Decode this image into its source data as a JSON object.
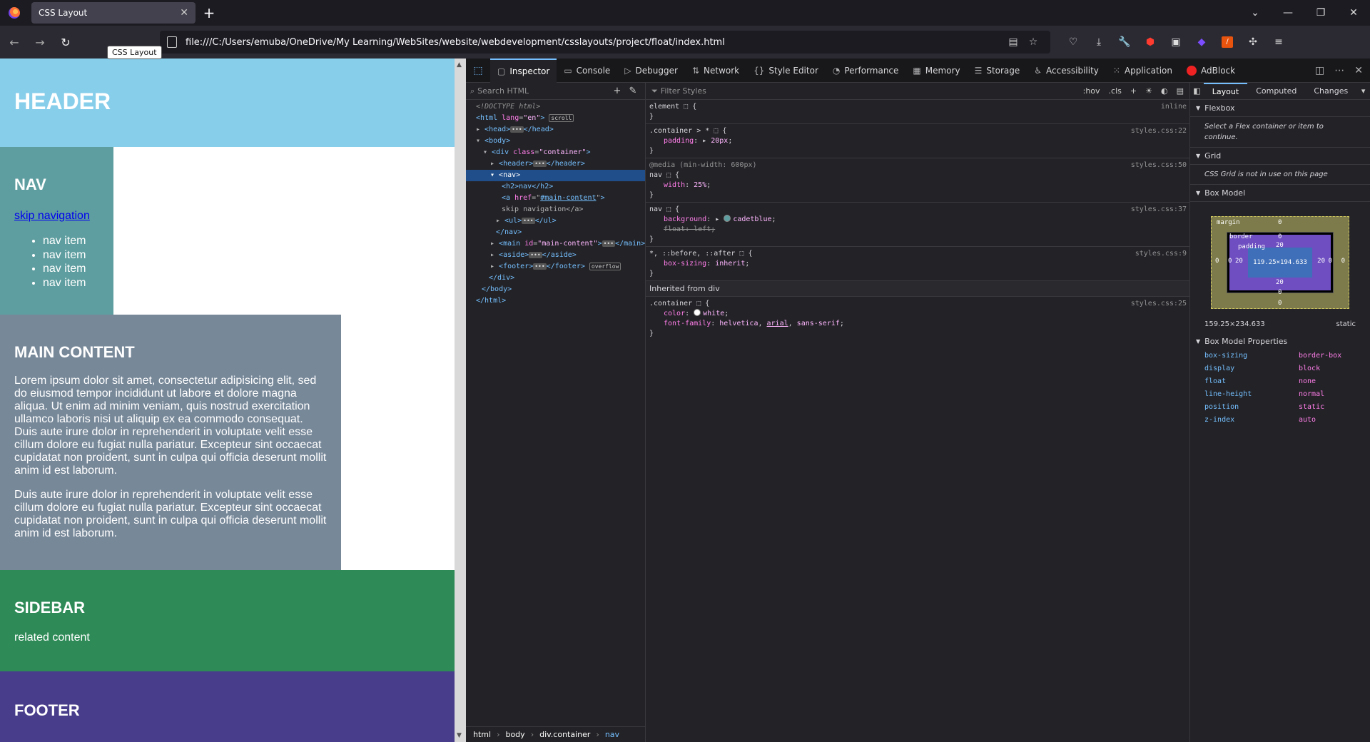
{
  "browser": {
    "tab_title": "CSS Layout",
    "tooltip": "CSS Layout",
    "url": "file:///C:/Users/emuba/OneDrive/My Learning/WebSites/website/webdevelopment/csslayouts/project/float/index.html"
  },
  "page": {
    "header_title": "HEADER",
    "nav_title": "NAV",
    "skip_link": "skip navigation",
    "nav_items": [
      "nav item",
      "nav item",
      "nav item",
      "nav item"
    ],
    "main_title": "MAIN CONTENT",
    "main_p1": "Lorem ipsum dolor sit amet, consectetur adipisicing elit, sed do eiusmod tempor incididunt ut labore et dolore magna aliqua. Ut enim ad minim veniam, quis nostrud exercitation ullamco laboris nisi ut aliquip ex ea commodo consequat. Duis aute irure dolor in reprehenderit in voluptate velit esse cillum dolore eu fugiat nulla pariatur. Excepteur sint occaecat cupidatat non proident, sunt in culpa qui officia deserunt mollit anim id est laborum.",
    "main_p2": "Duis aute irure dolor in reprehenderit in voluptate velit esse cillum dolore eu fugiat nulla pariatur. Excepteur sint occaecat cupidatat non proident, sunt in culpa qui officia deserunt mollit anim id est laborum.",
    "sidebar_title": "SIDEBAR",
    "sidebar_text": "related content",
    "footer_title": "FOOTER"
  },
  "devtools": {
    "tabs": [
      "Inspector",
      "Console",
      "Debugger",
      "Network",
      "Style Editor",
      "Performance",
      "Memory",
      "Storage",
      "Accessibility",
      "Application",
      "AdBlock"
    ],
    "search_placeholder": "Search HTML",
    "filter_placeholder": "Filter Styles",
    "hov": ":hov",
    "cls": ".cls",
    "markup": {
      "doctype": "<!DOCTYPE html>",
      "html_open": "<html",
      "lang_attr": "lang",
      "lang_val": "\"en\"",
      "scroll_badge": "scroll",
      "head_open": "<head>",
      "head_close": "</head>",
      "body": "<body>",
      "div_open": "<div",
      "class_attr": "class",
      "container_val": "\"container\"",
      "header_open": "<header>",
      "header_close": "</header>",
      "nav": "<nav>",
      "h2_line": "<h2>nav</h2>",
      "a_open": "<a",
      "href_attr": "href",
      "href_val": "#main-content",
      "skip_text": "skip navigation</a>",
      "ul_open": "<ul>",
      "ul_close": "</ul>",
      "nav_close": "</nav>",
      "main_open": "<main",
      "id_attr": "id",
      "main_id": "\"main-content\"",
      "main_close": "</main>",
      "aside_open": "<aside>",
      "aside_close": "</aside>",
      "footer_open": "<footer>",
      "footer_close": "</footer>",
      "overflow_badge": "overflow",
      "div_close": "</div>",
      "body_close": "</body>",
      "html_close": "</html>",
      "ellipsis": "•••"
    },
    "breadcrumbs": [
      "html",
      "body",
      "div.container",
      "nav"
    ],
    "rules": {
      "element_selector": "element",
      "element_src": "inline",
      "r1_selector": ".container > * ",
      "r1_src": "styles.css:22",
      "r1_prop": "padding",
      "r1_val": "20px",
      "media": "@media (min-width: 600px)",
      "r2_selector": "nav ",
      "r2_src": "styles.css:50",
      "r2_prop": "width",
      "r2_val": "25%",
      "r3_selector": "nav ",
      "r3_src": "styles.css:37",
      "r3_prop1": "background",
      "r3_val1": "cadetblue",
      "r3_prop2": "float: left;",
      "r4_selector": "*, ::before, ::after ",
      "r4_src": "styles.css:9",
      "r4_prop": "box-sizing",
      "r4_val": "inherit",
      "inherited_head": "Inherited from div",
      "r5_selector": ".container ",
      "r5_src": "styles.css:25",
      "r5_prop1": "color",
      "r5_val1": "white",
      "r5_prop2": "font-family",
      "r5_val2a": "helvetica",
      "r5_val2b": "arial",
      "r5_val2c": "sans-serif",
      "swatch_cadetblue": "#5f9ea0",
      "swatch_white": "#ffffff"
    },
    "layout": {
      "tabs": [
        "Layout",
        "Computed",
        "Changes"
      ],
      "flexbox_title": "Flexbox",
      "flexbox_msg": "Select a Flex container or item to continue.",
      "grid_title": "Grid",
      "grid_msg": "CSS Grid is not in use on this page",
      "boxmodel_title": "Box Model",
      "bm_margin": "margin",
      "bm_border": "border",
      "bm_padding": "padding",
      "bm_content": "119.25×194.633",
      "bm_zero": "0",
      "bm_twenty": "20",
      "dims": "159.25×234.633",
      "position": "static",
      "props_title": "Box Model Properties",
      "props": [
        {
          "name": "box-sizing",
          "value": "border-box"
        },
        {
          "name": "display",
          "value": "block"
        },
        {
          "name": "float",
          "value": "none"
        },
        {
          "name": "line-height",
          "value": "normal"
        },
        {
          "name": "position",
          "value": "static"
        },
        {
          "name": "z-index",
          "value": "auto"
        }
      ]
    }
  }
}
